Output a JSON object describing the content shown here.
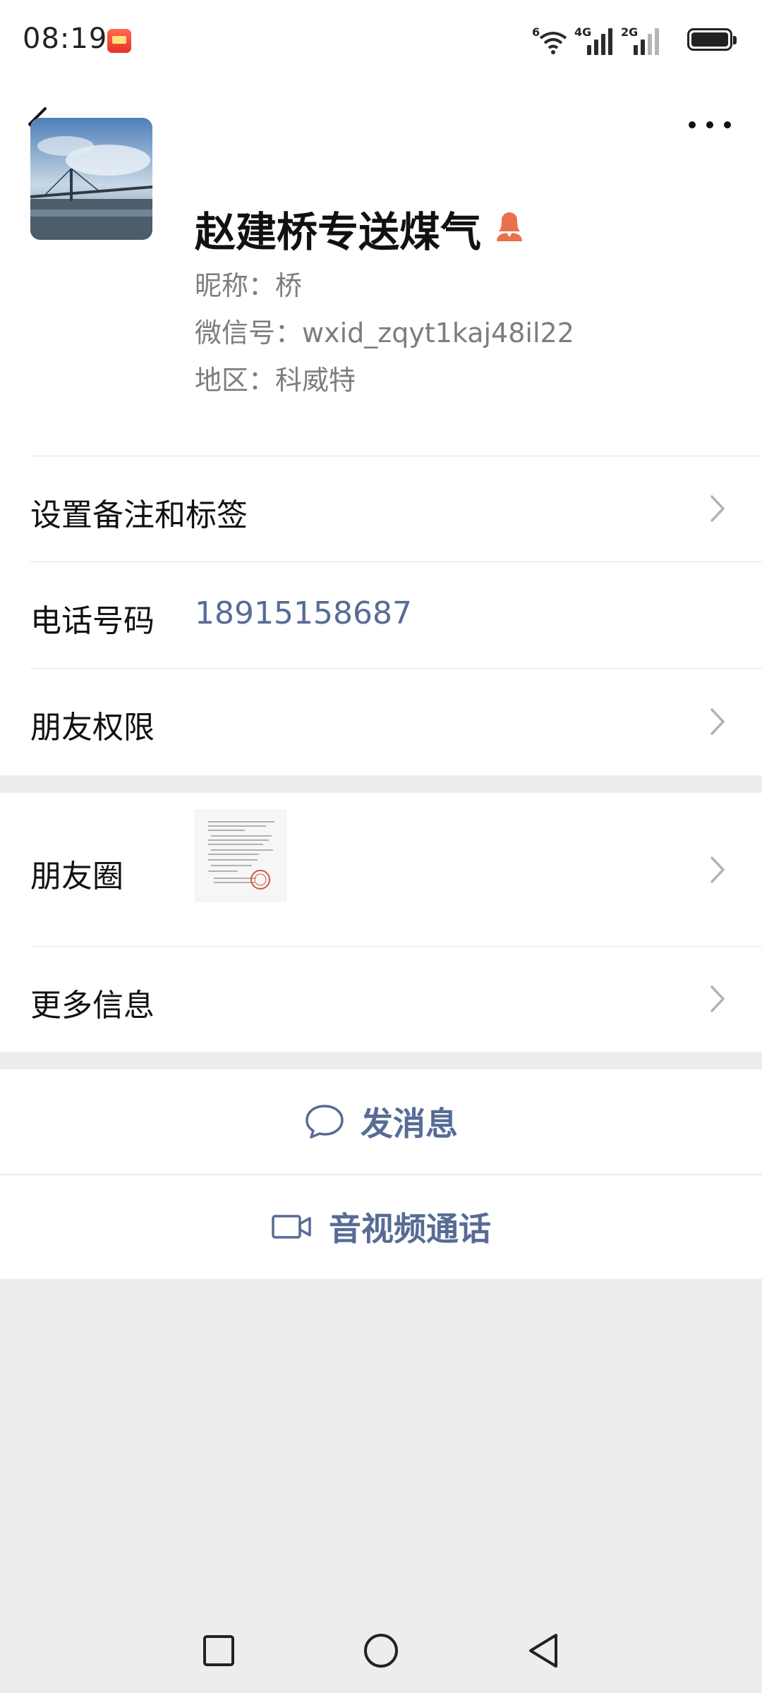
{
  "status_bar": {
    "time": "08:19",
    "wifi_badge": "6",
    "sim1_label": "4G",
    "sim2_label": "2G"
  },
  "nav": {
    "back_icon": "chevron-left-icon",
    "more_icon": "more-dots-icon"
  },
  "profile": {
    "display_name": "赵建桥专送煤气",
    "nickname": "昵称：桥",
    "wechat_id": "微信号：wxid_zqyt1kaj48il22",
    "region": "地区：科威特",
    "gender_icon": "female-icon",
    "gender_color": "#e9704c"
  },
  "rows": {
    "remarks": "设置备注和标签",
    "phone_label": "电话号码",
    "phone_value": "18915158687",
    "permissions": "朋友权限",
    "moments": "朋友圈",
    "more_info": "更多信息"
  },
  "actions": {
    "message": "发消息",
    "call": "音视频通话"
  },
  "colors": {
    "link_blue": "#576b95",
    "background": "#ededed"
  }
}
